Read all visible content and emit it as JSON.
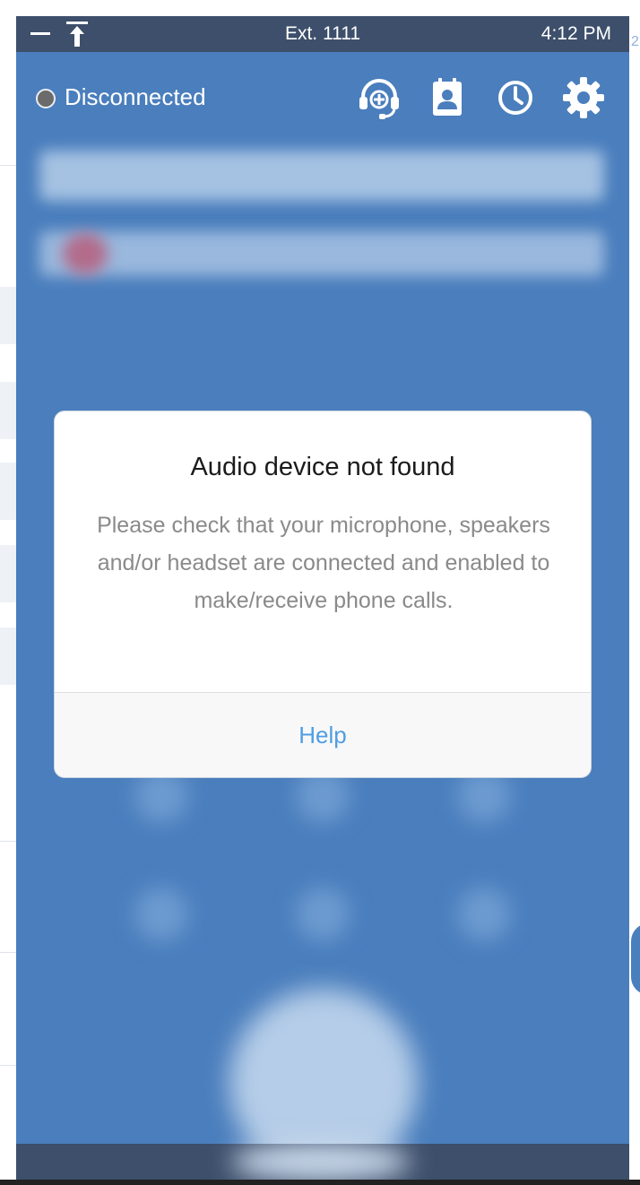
{
  "titlebar": {
    "extension": "Ext. 1111",
    "time": "4:12 PM",
    "minimize_icon": "minimize-icon",
    "pin_icon": "pin-top-icon"
  },
  "status": {
    "label": "Disconnected",
    "dot_color": "#6b6b6b"
  },
  "header_icons": [
    {
      "name": "add-headset-icon"
    },
    {
      "name": "contacts-icon"
    },
    {
      "name": "history-clock-icon"
    },
    {
      "name": "settings-gear-icon"
    }
  ],
  "dialog": {
    "title": "Audio device not found",
    "message": "Please check that your microphone, speakers and/or headset are connected and enabled to make/receive phone calls.",
    "action_label": "Help"
  },
  "background": {
    "right_edge_text": "2"
  },
  "colors": {
    "panel_blue": "#4a7ebd",
    "bar_dark": "#3d4f6b",
    "link_blue": "#4e9ee4"
  }
}
